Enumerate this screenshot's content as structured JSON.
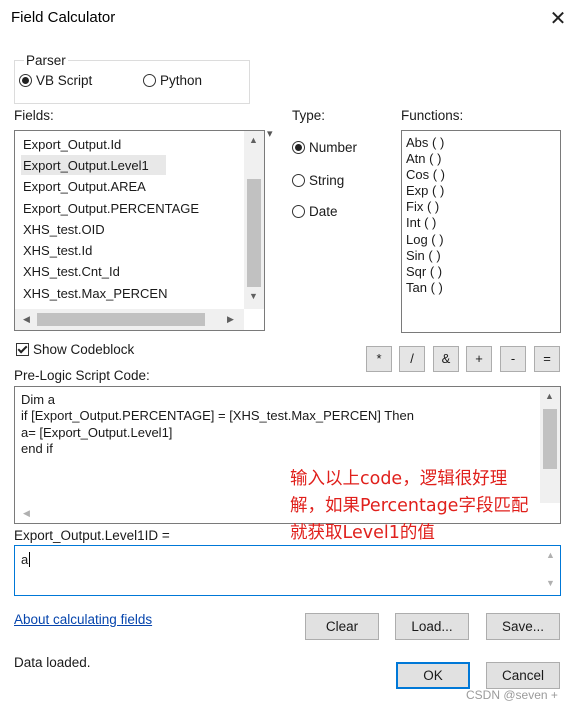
{
  "window": {
    "title": "Field Calculator",
    "close_glyph": "✕"
  },
  "parser": {
    "label": "Parser",
    "options": [
      {
        "label": "VB Script",
        "selected": true
      },
      {
        "label": "Python",
        "selected": false
      }
    ]
  },
  "fields": {
    "label": "Fields:",
    "items": [
      "Export_Output.Id",
      "Export_Output.Level1",
      "Export_Output.AREA",
      "Export_Output.PERCENTAGE",
      "XHS_test.OID",
      "XHS_test.Id",
      "XHS_test.Cnt_Id",
      "XHS_test.Max_PERCEN"
    ],
    "selected_index": 1
  },
  "type": {
    "label": "Type:",
    "options": [
      {
        "label": "Number",
        "selected": true
      },
      {
        "label": "String",
        "selected": false
      },
      {
        "label": "Date",
        "selected": false
      }
    ]
  },
  "functions": {
    "label": "Functions:",
    "items": [
      "Abs ( )",
      "Atn ( )",
      "Cos ( )",
      "Exp ( )",
      "Fix ( )",
      "Int ( )",
      "Log ( )",
      "Sin ( )",
      "Sqr ( )",
      "Tan ( )"
    ]
  },
  "show_codeblock": {
    "label": "Show Codeblock",
    "checked": true
  },
  "operators": [
    "*",
    "/",
    "&",
    "+",
    "-",
    "="
  ],
  "pre_logic": {
    "label": "Pre-Logic Script Code:",
    "lines": [
      "Dim a",
      "if [Export_Output.PERCENTAGE] = [XHS_test.Max_PERCEN] Then",
      "a= [Export_Output.Level1]",
      "end if"
    ]
  },
  "annotation": {
    "lines": [
      "输入以上code，逻辑很好理",
      "解，如果Percentage字段匹配",
      "就获取Level1的值"
    ],
    "color": "#e0201c"
  },
  "expression": {
    "label": "Export_Output.Level1ID =",
    "value": "a"
  },
  "link": {
    "text": "About calculating fields"
  },
  "buttons": {
    "clear": "Clear",
    "load": "Load...",
    "save": "Save...",
    "ok": "OK",
    "cancel": "Cancel"
  },
  "status": "Data loaded.",
  "watermark": "CSDN @seven +",
  "colors": {
    "accent": "#0078d7",
    "link": "#0645ad"
  },
  "icons": {
    "scroll_up": "▲",
    "scroll_down": "▼",
    "scroll_left": "◀",
    "scroll_right": "▶",
    "dropdown": "▾"
  }
}
